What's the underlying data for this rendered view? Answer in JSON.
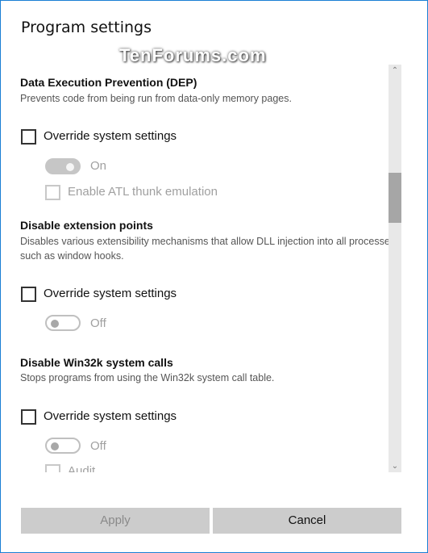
{
  "title": "Program settings",
  "watermark": "TenForums.com",
  "sections": [
    {
      "heading": "Data Execution Prevention (DEP)",
      "description": "Prevents code from being run from data-only memory pages.",
      "override_label": "Override system settings",
      "override_checked": false,
      "toggle_state": "On",
      "sub_option": "Enable ATL thunk emulation"
    },
    {
      "heading": "Disable extension points",
      "description_line1": "Disables various extensibility mechanisms that allow DLL injection into all processes,",
      "description_line2": "such as window hooks.",
      "override_label": "Override system settings",
      "override_checked": false,
      "toggle_state": "Off"
    },
    {
      "heading": "Disable Win32k system calls",
      "description": "Stops programs from using the Win32k system call table.",
      "override_label": "Override system settings",
      "override_checked": false,
      "toggle_state": "Off",
      "sub_option": "Audit"
    }
  ],
  "buttons": {
    "apply": "Apply",
    "cancel": "Cancel"
  },
  "scroll_position_percent": 30
}
